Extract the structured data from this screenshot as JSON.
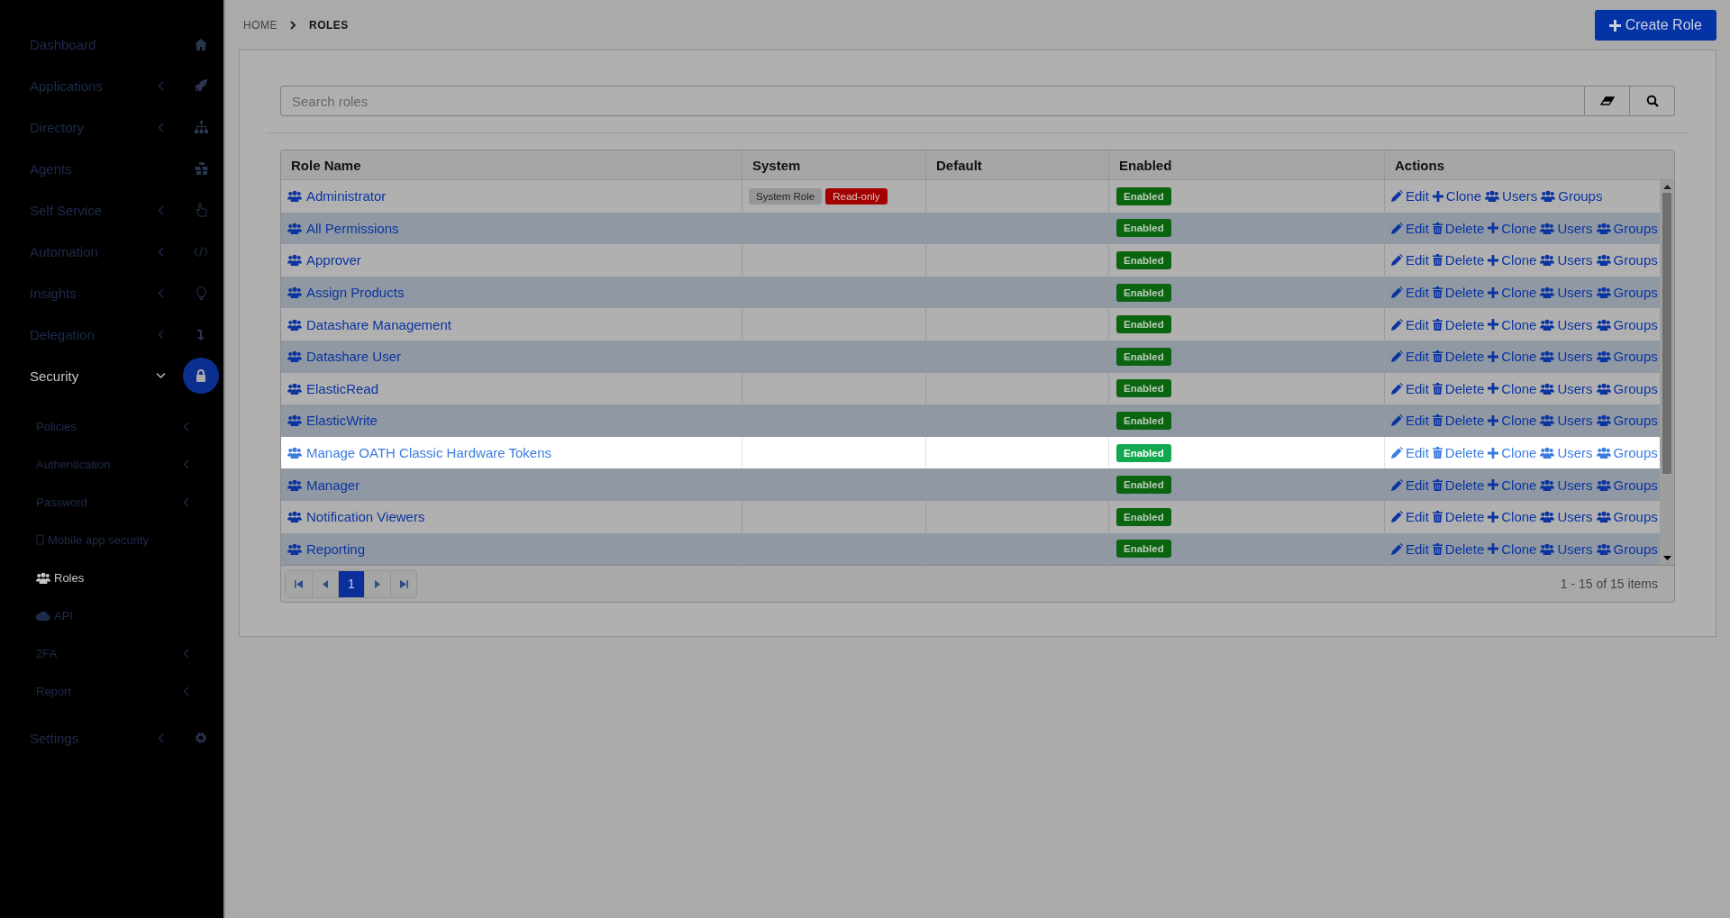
{
  "sidebar": {
    "items": [
      {
        "label": "Dashboard",
        "submenu": false,
        "expanded": false,
        "selected": false
      },
      {
        "label": "Applications",
        "submenu": true,
        "expanded": false,
        "selected": false
      },
      {
        "label": "Directory",
        "submenu": true,
        "expanded": false,
        "selected": false
      },
      {
        "label": "Agents",
        "submenu": false,
        "expanded": false,
        "selected": false
      },
      {
        "label": "Self Service",
        "submenu": true,
        "expanded": false,
        "selected": false
      },
      {
        "label": "Automation",
        "submenu": true,
        "expanded": false,
        "selected": false
      },
      {
        "label": "Insights",
        "submenu": true,
        "expanded": false,
        "selected": false
      },
      {
        "label": "Delegation",
        "submenu": true,
        "expanded": false,
        "selected": false
      },
      {
        "label": "Security",
        "submenu": true,
        "expanded": true,
        "selected": true,
        "children": [
          {
            "label": "Policies",
            "submenu": true,
            "selected": false
          },
          {
            "label": "Authentication",
            "submenu": true,
            "selected": false
          },
          {
            "label": "Password",
            "submenu": true,
            "selected": false
          },
          {
            "label": "Mobile app security",
            "submenu": false,
            "selected": false
          },
          {
            "label": "Roles",
            "submenu": false,
            "selected": true
          },
          {
            "label": "API",
            "submenu": false,
            "selected": false
          },
          {
            "label": "2FA",
            "submenu": true,
            "selected": false
          },
          {
            "label": "Report",
            "submenu": true,
            "selected": false
          }
        ]
      },
      {
        "label": "Settings",
        "submenu": true,
        "expanded": false,
        "selected": false
      }
    ]
  },
  "breadcrumb": [
    "HOME",
    "ROLES"
  ],
  "create_button": "Create Role",
  "search": {
    "placeholder": "Search roles"
  },
  "table": {
    "columns": [
      "Role Name",
      "System",
      "Default",
      "Enabled",
      "Actions"
    ],
    "rows": [
      {
        "name": "Administrator",
        "badges": [
          {
            "kind": "system",
            "label": "System Role"
          },
          {
            "kind": "readonly",
            "label": "Read-only"
          }
        ],
        "enabled": "Enabled",
        "highlighted": false,
        "actions": [
          {
            "kind": "edit",
            "label": "Edit"
          },
          {
            "kind": "clone",
            "label": "Clone"
          },
          {
            "kind": "users",
            "label": "Users"
          },
          {
            "kind": "groups",
            "label": "Groups"
          }
        ]
      },
      {
        "name": "All Permissions",
        "badges": [],
        "enabled": "Enabled",
        "highlighted": false,
        "actions": [
          {
            "kind": "edit",
            "label": "Edit"
          },
          {
            "kind": "delete",
            "label": "Delete"
          },
          {
            "kind": "clone",
            "label": "Clone"
          },
          {
            "kind": "users",
            "label": "Users"
          },
          {
            "kind": "groups",
            "label": "Groups"
          }
        ]
      },
      {
        "name": "Approver",
        "badges": [],
        "enabled": "Enabled",
        "highlighted": false,
        "actions": [
          {
            "kind": "edit",
            "label": "Edit"
          },
          {
            "kind": "delete",
            "label": "Delete"
          },
          {
            "kind": "clone",
            "label": "Clone"
          },
          {
            "kind": "users",
            "label": "Users"
          },
          {
            "kind": "groups",
            "label": "Groups"
          }
        ]
      },
      {
        "name": "Assign Products",
        "badges": [],
        "enabled": "Enabled",
        "highlighted": false,
        "actions": [
          {
            "kind": "edit",
            "label": "Edit"
          },
          {
            "kind": "delete",
            "label": "Delete"
          },
          {
            "kind": "clone",
            "label": "Clone"
          },
          {
            "kind": "users",
            "label": "Users"
          },
          {
            "kind": "groups",
            "label": "Groups"
          }
        ]
      },
      {
        "name": "Datashare Management",
        "badges": [],
        "enabled": "Enabled",
        "highlighted": false,
        "actions": [
          {
            "kind": "edit",
            "label": "Edit"
          },
          {
            "kind": "delete",
            "label": "Delete"
          },
          {
            "kind": "clone",
            "label": "Clone"
          },
          {
            "kind": "users",
            "label": "Users"
          },
          {
            "kind": "groups",
            "label": "Groups"
          }
        ]
      },
      {
        "name": "Datashare User",
        "badges": [],
        "enabled": "Enabled",
        "highlighted": false,
        "actions": [
          {
            "kind": "edit",
            "label": "Edit"
          },
          {
            "kind": "delete",
            "label": "Delete"
          },
          {
            "kind": "clone",
            "label": "Clone"
          },
          {
            "kind": "users",
            "label": "Users"
          },
          {
            "kind": "groups",
            "label": "Groups"
          }
        ]
      },
      {
        "name": "ElasticRead",
        "badges": [],
        "enabled": "Enabled",
        "highlighted": false,
        "actions": [
          {
            "kind": "edit",
            "label": "Edit"
          },
          {
            "kind": "delete",
            "label": "Delete"
          },
          {
            "kind": "clone",
            "label": "Clone"
          },
          {
            "kind": "users",
            "label": "Users"
          },
          {
            "kind": "groups",
            "label": "Groups"
          }
        ]
      },
      {
        "name": "ElasticWrite",
        "badges": [],
        "enabled": "Enabled",
        "highlighted": false,
        "actions": [
          {
            "kind": "edit",
            "label": "Edit"
          },
          {
            "kind": "delete",
            "label": "Delete"
          },
          {
            "kind": "clone",
            "label": "Clone"
          },
          {
            "kind": "users",
            "label": "Users"
          },
          {
            "kind": "groups",
            "label": "Groups"
          }
        ]
      },
      {
        "name": "Manage OATH Classic Hardware Tokens",
        "badges": [],
        "enabled": "Enabled",
        "highlighted": true,
        "actions": [
          {
            "kind": "edit",
            "label": "Edit"
          },
          {
            "kind": "delete",
            "label": "Delete"
          },
          {
            "kind": "clone",
            "label": "Clone"
          },
          {
            "kind": "users",
            "label": "Users"
          },
          {
            "kind": "groups",
            "label": "Groups"
          }
        ]
      },
      {
        "name": "Manager",
        "badges": [],
        "enabled": "Enabled",
        "highlighted": false,
        "actions": [
          {
            "kind": "edit",
            "label": "Edit"
          },
          {
            "kind": "delete",
            "label": "Delete"
          },
          {
            "kind": "clone",
            "label": "Clone"
          },
          {
            "kind": "users",
            "label": "Users"
          },
          {
            "kind": "groups",
            "label": "Groups"
          }
        ]
      },
      {
        "name": "Notification Viewers",
        "badges": [],
        "enabled": "Enabled",
        "highlighted": false,
        "actions": [
          {
            "kind": "edit",
            "label": "Edit"
          },
          {
            "kind": "delete",
            "label": "Delete"
          },
          {
            "kind": "clone",
            "label": "Clone"
          },
          {
            "kind": "users",
            "label": "Users"
          },
          {
            "kind": "groups",
            "label": "Groups"
          }
        ]
      },
      {
        "name": "Reporting",
        "badges": [],
        "enabled": "Enabled",
        "highlighted": false,
        "actions": [
          {
            "kind": "edit",
            "label": "Edit"
          },
          {
            "kind": "delete",
            "label": "Delete"
          },
          {
            "kind": "clone",
            "label": "Clone"
          },
          {
            "kind": "users",
            "label": "Users"
          },
          {
            "kind": "groups",
            "label": "Groups"
          }
        ]
      }
    ]
  },
  "pagination": {
    "pages": [
      {
        "label": "1",
        "selected": true
      }
    ],
    "summary": "1 - 15 of 15 items"
  }
}
